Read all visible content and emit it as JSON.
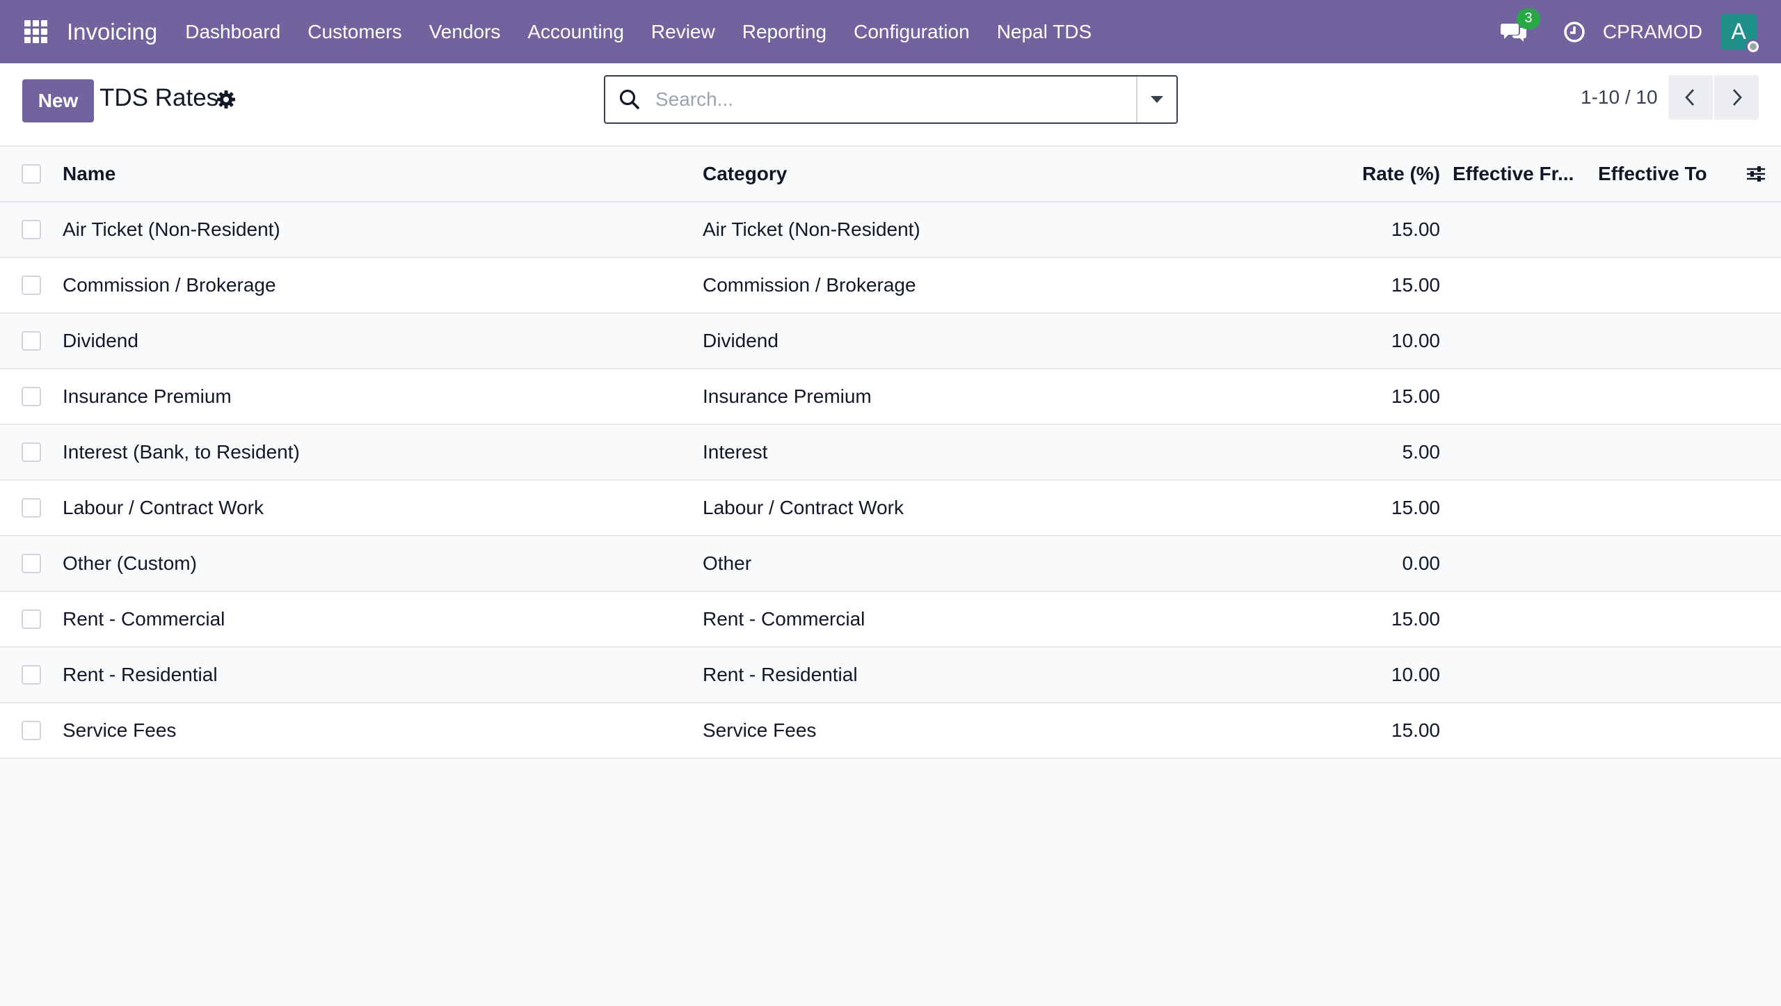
{
  "navbar": {
    "app_name": "Invoicing",
    "menu": [
      "Dashboard",
      "Customers",
      "Vendors",
      "Accounting",
      "Review",
      "Reporting",
      "Configuration",
      "Nepal TDS"
    ],
    "chat_count": "3",
    "user_name": "CPRAMOD",
    "avatar_initial": "A",
    "brand_color": "#71639e"
  },
  "control": {
    "new_label": "New",
    "title": "TDS Rates",
    "search_placeholder": "Search...",
    "pager": "1-10 / 10"
  },
  "table": {
    "headers": {
      "name": "Name",
      "category": "Category",
      "rate": "Rate (%)",
      "effective_from": "Effective Fr...",
      "effective_to": "Effective To"
    },
    "rows": [
      {
        "name": "Air Ticket (Non-Resident)",
        "category": "Air Ticket (Non-Resident)",
        "rate": "15.00"
      },
      {
        "name": "Commission / Brokerage",
        "category": "Commission / Brokerage",
        "rate": "15.00"
      },
      {
        "name": "Dividend",
        "category": "Dividend",
        "rate": "10.00"
      },
      {
        "name": "Insurance Premium",
        "category": "Insurance Premium",
        "rate": "15.00"
      },
      {
        "name": "Interest (Bank, to Resident)",
        "category": "Interest",
        "rate": "5.00"
      },
      {
        "name": "Labour / Contract Work",
        "category": "Labour / Contract Work",
        "rate": "15.00"
      },
      {
        "name": "Other (Custom)",
        "category": "Other",
        "rate": "0.00"
      },
      {
        "name": "Rent - Commercial",
        "category": "Rent - Commercial",
        "rate": "15.00"
      },
      {
        "name": "Rent - Residential",
        "category": "Rent - Residential",
        "rate": "10.00"
      },
      {
        "name": "Service Fees",
        "category": "Service Fees",
        "rate": "15.00"
      }
    ]
  }
}
